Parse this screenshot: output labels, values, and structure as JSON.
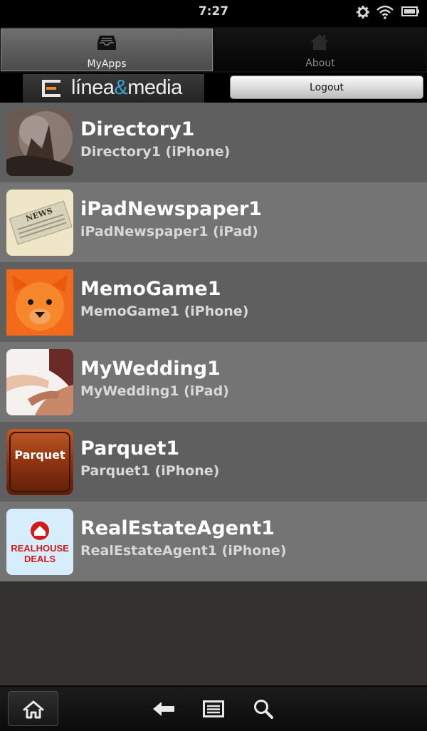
{
  "status_bar": {
    "time": "7:27",
    "icons": [
      "settings-gear-icon",
      "wifi-icon",
      "battery-icon"
    ]
  },
  "tabs": [
    {
      "label": "MyApps",
      "icon": "inbox-tray-icon",
      "selected": true
    },
    {
      "label": "About",
      "icon": "house-icon",
      "selected": false
    }
  ],
  "header": {
    "logo_text_main": "línea",
    "logo_text_amp": "&",
    "logo_text_end": "media",
    "logout_label": "Logout"
  },
  "apps": [
    {
      "title": "Directory1",
      "subtitle": "Directory1 (iPhone)",
      "thumb": "tree-photo"
    },
    {
      "title": "iPadNewspaper1",
      "subtitle": "iPadNewspaper1 (iPad)",
      "thumb": "newspaper"
    },
    {
      "title": "MemoGame1",
      "subtitle": "MemoGame1 (iPhone)",
      "thumb": "orange-bear"
    },
    {
      "title": "MyWedding1",
      "subtitle": "MyWedding1 (iPad)",
      "thumb": "wedding-hands"
    },
    {
      "title": "Parquet1",
      "subtitle": "Parquet1 (iPhone)",
      "thumb": "parquet-wood",
      "thumb_text": "Parquet"
    },
    {
      "title": "RealEstateAgent1",
      "subtitle": "RealEstateAgent1 (iPhone)",
      "thumb": "real-house-deals",
      "thumb_text_1": "REALHOUSE",
      "thumb_text_2": "DEALS"
    }
  ],
  "colors": {
    "row_dark": "#5f5f5f",
    "row_light": "#747474",
    "background": "#34322e",
    "logo_accent": "#3aa6d6"
  },
  "nav_bar": {
    "icons": [
      "home-icon",
      "back-arrow-icon",
      "menu-icon",
      "search-icon"
    ]
  }
}
